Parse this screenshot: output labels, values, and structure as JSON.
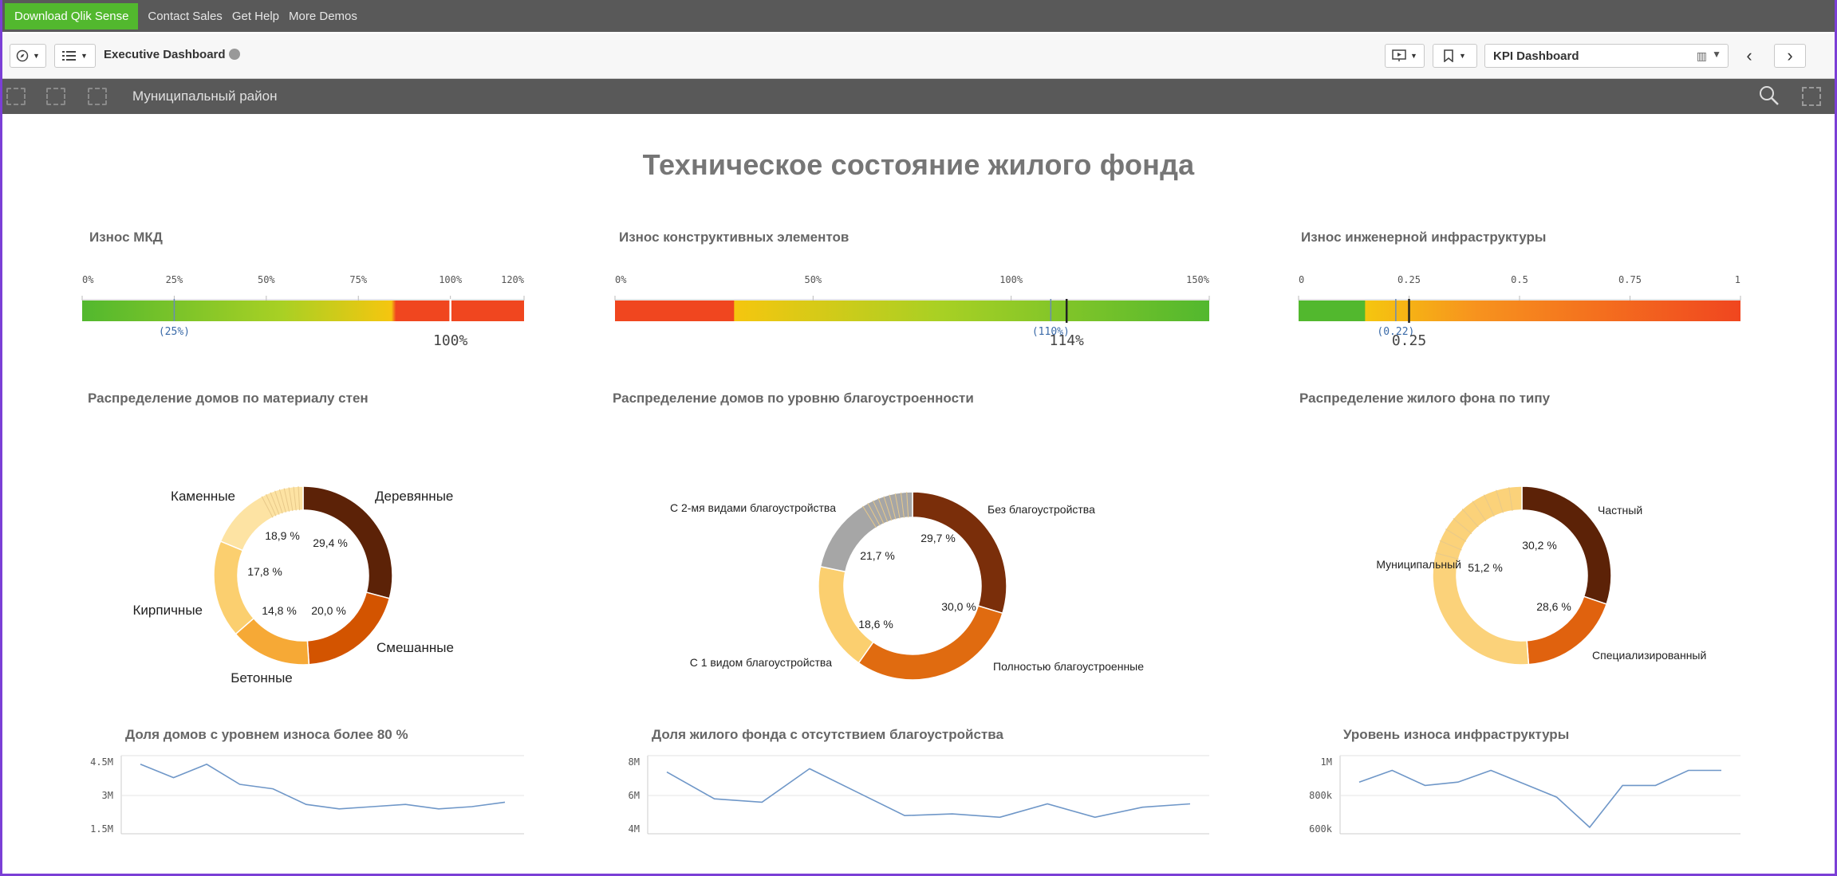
{
  "promo": {
    "download": "Download Qlik Sense",
    "links": [
      "Contact Sales",
      "Get Help",
      "More Demos"
    ]
  },
  "toolbar": {
    "nav_icon": "compass-icon",
    "menu_icon": "list-icon",
    "app_title": "Executive Dashboard",
    "present_icon": "presentation-icon",
    "bookmark_icon": "bookmark-icon",
    "sheet": "KPI Dashboard",
    "sheet_icon": "chart-icon",
    "prev_icon": "chevron-left-icon",
    "next_icon": "chevron-right-icon"
  },
  "selections": {
    "field": "Муниципальный район",
    "search_icon": "search-icon",
    "lasso_icon": "lasso-icon"
  },
  "sheet_title": "Техническое состояние жилого фонда",
  "colors": {
    "green": "#52b82e",
    "red": "#f0461f",
    "yellow": "#f5c60f",
    "line": "#6f97c8",
    "donut_dark": "#5c2207"
  },
  "gauges": [
    {
      "title": "Износ МКД",
      "ticks": [
        "0%",
        "25%",
        "50%",
        "75%",
        "100%",
        "120%"
      ],
      "tick_values": [
        0,
        25,
        50,
        75,
        100,
        120
      ],
      "max": 120,
      "target_label": "(25%)",
      "target": 25,
      "value_label": "100%",
      "value": 100,
      "stops": [
        [
          0,
          "#52b82e"
        ],
        [
          0.45,
          "#a8d024"
        ],
        [
          0.7,
          "#f5c60f"
        ],
        [
          0.71,
          "#f0461f"
        ],
        [
          1,
          "#f0461f"
        ]
      ],
      "direction": "normal"
    },
    {
      "title": "Износ конструктивных элементов",
      "ticks": [
        "0%",
        "50%",
        "100%",
        "150%"
      ],
      "tick_values": [
        0,
        50,
        100,
        150
      ],
      "max": 150,
      "target_label": "(110%)",
      "target": 110,
      "value_label": "114%",
      "value": 114,
      "stops": [
        [
          0,
          "#f0461f"
        ],
        [
          0.2,
          "#f0461f"
        ],
        [
          0.201,
          "#f5c60f"
        ],
        [
          0.55,
          "#a8d024"
        ],
        [
          1,
          "#52b82e"
        ]
      ],
      "direction": "reverse"
    },
    {
      "title": "Износ инженерной инфраструктуры",
      "ticks": [
        "0",
        "0.25",
        "0.5",
        "0.75",
        "1"
      ],
      "tick_values": [
        0,
        0.25,
        0.5,
        0.75,
        1
      ],
      "max": 1,
      "target_label": "(0.22)",
      "target": 0.22,
      "value_label": "0.25",
      "value": 0.25,
      "stops": [
        [
          0,
          "#52b82e"
        ],
        [
          0.15,
          "#52b82e"
        ],
        [
          0.151,
          "#f5c60f"
        ],
        [
          0.4,
          "#f7931e"
        ],
        [
          1,
          "#f0461f"
        ]
      ],
      "direction": "normal"
    }
  ],
  "donuts": [
    {
      "title": "Распределение домов по материалу стен",
      "slices": [
        {
          "name": "Деревянные",
          "value": 29.4,
          "label": "29,4 %",
          "color": "#5c2207"
        },
        {
          "name": "Смешанные",
          "value": 20.0,
          "label": "20,0 %",
          "color": "#d35400"
        },
        {
          "name": "Бетонные",
          "value": 14.8,
          "label": "14,8 %",
          "color": "#f6a936"
        },
        {
          "name": "Кирпичные",
          "value": 17.8,
          "label": "17,8 %",
          "color": "#fbcf6f"
        },
        {
          "name": "Каменные",
          "value": 18.9,
          "label": "18,9 %",
          "color": "#fde3a3"
        }
      ]
    },
    {
      "title": "Распределение домов по уровню благоустроенности",
      "slices": [
        {
          "name": "Без благоустройства",
          "value": 29.7,
          "label": "29,7 %",
          "color": "#7a2e0a"
        },
        {
          "name": "Полностью благоустроенные",
          "value": 30.0,
          "label": "30,0 %",
          "color": "#e06b10"
        },
        {
          "name": "С 1 видом благоустройства",
          "value": 18.6,
          "label": "18,6 %",
          "color": "#fbcf6f"
        },
        {
          "name": "С 2-мя видами благоустройства",
          "value": 21.7,
          "label": "21,7 %",
          "color": "#a6a6a6"
        }
      ]
    },
    {
      "title": "Распределение жилого фона по типу",
      "slices": [
        {
          "name": "Частный",
          "value": 30.2,
          "label": "30,2 %",
          "color": "#5c2207"
        },
        {
          "name": "Специализированный",
          "value": 18.6,
          "label": "28,6 %",
          "color": "#e0620e"
        },
        {
          "name": "Муниципальный",
          "value": 51.2,
          "label": "51,2 %",
          "color": "#fbd27a"
        }
      ]
    }
  ],
  "chart_data": [
    {
      "type": "line",
      "title": "Доля домов с уровнем износа более 80 %",
      "y_ticks": [
        "4.5M",
        "3M",
        "1.5M"
      ],
      "ylim": [
        1500000,
        4500000
      ],
      "values": [
        4400000,
        3800000,
        4400000,
        3500000,
        3300000,
        2600000,
        2400000,
        2500000,
        2600000,
        2400000,
        2500000,
        2700000
      ]
    },
    {
      "type": "line",
      "title": "Доля жилого фонда с отсутствием благоустройства",
      "y_ticks": [
        "8M",
        "6M",
        "4M"
      ],
      "ylim": [
        4000000,
        8000000
      ],
      "values": [
        7400000,
        5800000,
        5600000,
        7600000,
        6200000,
        4800000,
        4900000,
        4700000,
        5500000,
        4700000,
        5300000,
        5500000
      ]
    },
    {
      "type": "line",
      "title": "Уровень износа инфраструктуры",
      "y_ticks": [
        "1M",
        "800k",
        "600k"
      ],
      "ylim": [
        600000,
        1000000
      ],
      "values": [
        880000,
        950000,
        860000,
        880000,
        950000,
        870000,
        790000,
        610000,
        860000,
        860000,
        950000,
        950000
      ]
    }
  ]
}
